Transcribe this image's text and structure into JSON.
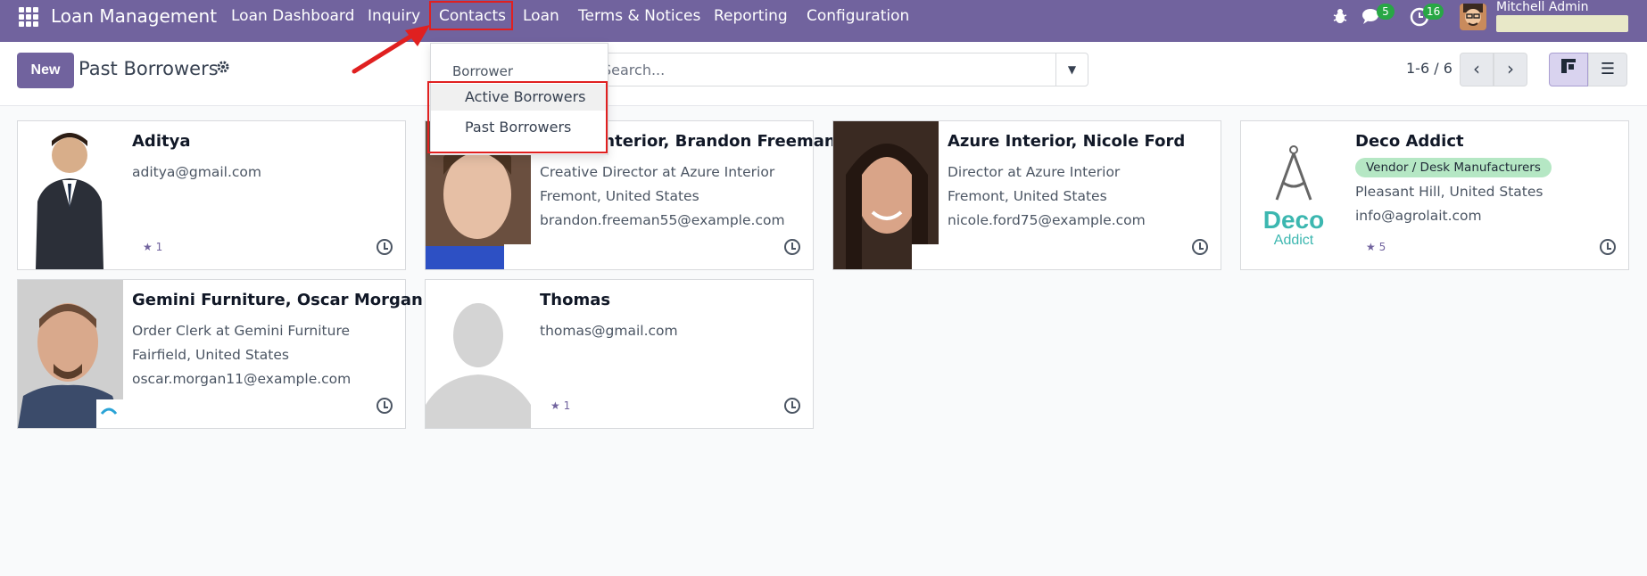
{
  "app": {
    "brand": "Loan Management",
    "menus": [
      "Loan Dashboard",
      "Inquiry",
      "Contacts",
      "Loan",
      "Terms & Notices",
      "Reporting",
      "Configuration"
    ],
    "messages_count": "5",
    "activities_count": "16",
    "user_name": "Mitchell Admin"
  },
  "control": {
    "new_label": "New",
    "title": "Past Borrowers",
    "search_placeholder": "Search...",
    "pager": "1-6 / 6"
  },
  "dropdown": {
    "header": "Borrower",
    "items": [
      "Active Borrowers",
      "Past Borrowers"
    ]
  },
  "cards": [
    {
      "name": "Aditya",
      "lines": [
        "aditya@gmail.com"
      ],
      "stars": "1"
    },
    {
      "name": "Azure Interior, Brandon Freeman",
      "lines": [
        "Creative Director at Azure Interior",
        "Fremont, United States",
        "brandon.freeman55@example.com"
      ]
    },
    {
      "name": "Azure Interior, Nicole Ford",
      "lines": [
        "Director at Azure Interior",
        "Fremont, United States",
        "nicole.ford75@example.com"
      ]
    },
    {
      "name": "Deco Addict",
      "tag": "Vendor / Desk Manufacturers",
      "lines": [
        "Pleasant Hill, United States",
        "info@agrolait.com"
      ],
      "stars": "5",
      "logo_top": "Deco",
      "logo_bottom": "Addict"
    },
    {
      "name": "Gemini Furniture, Oscar Morgan",
      "lines": [
        "Order Clerk at Gemini Furniture",
        "Fairfield, United States",
        "oscar.morgan11@example.com"
      ]
    },
    {
      "name": "Thomas",
      "lines": [
        "thomas@gmail.com"
      ],
      "stars": "1"
    }
  ],
  "colors": {
    "brand": "#71639e",
    "highlight": "#e02020",
    "tag": "#b5e7c4",
    "badge": "#28a745"
  }
}
